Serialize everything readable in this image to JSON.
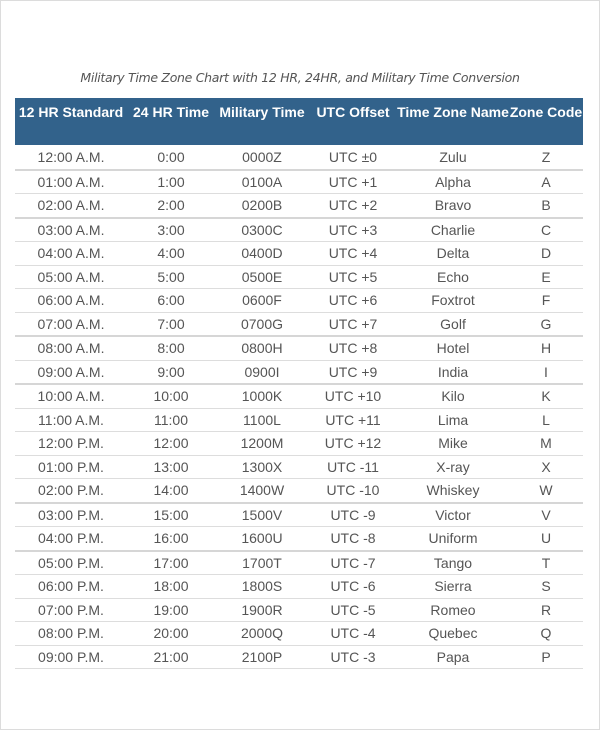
{
  "title": "Military Time Zone Chart with 12 HR, 24HR, and Military Time Conversion",
  "colors": {
    "header_bg": "#32628b",
    "header_text": "#ffffff",
    "cell_text": "#555555",
    "row_divider": "#dddddd"
  },
  "table": {
    "columns": [
      "12 HR Standard",
      "24 HR Time",
      "Military Time",
      "UTC Offset",
      "Time Zone Name",
      "Zone Code"
    ],
    "rows": [
      [
        "12:00 A.M.",
        "0:00",
        "0000Z",
        "UTC ±0",
        "Zulu",
        "Z"
      ],
      [
        "01:00 A.M.",
        "1:00",
        "0100A",
        "UTC +1",
        "Alpha",
        "A"
      ],
      [
        "02:00 A.M.",
        "2:00",
        "0200B",
        "UTC +2",
        "Bravo",
        "B"
      ],
      [
        "03:00 A.M.",
        "3:00",
        "0300C",
        "UTC +3",
        "Charlie",
        "C"
      ],
      [
        "04:00 A.M.",
        "4:00",
        "0400D",
        "UTC +4",
        "Delta",
        "D"
      ],
      [
        "05:00 A.M.",
        "5:00",
        "0500E",
        "UTC +5",
        "Echo",
        "E"
      ],
      [
        "06:00 A.M.",
        "6:00",
        "0600F",
        "UTC +6",
        "Foxtrot",
        "F"
      ],
      [
        "07:00 A.M.",
        "7:00",
        "0700G",
        "UTC +7",
        "Golf",
        "G"
      ],
      [
        "08:00 A.M.",
        "8:00",
        "0800H",
        "UTC +8",
        "Hotel",
        "H"
      ],
      [
        "09:00 A.M.",
        "9:00",
        "0900I",
        "UTC +9",
        "India",
        "I"
      ],
      [
        "10:00 A.M.",
        "10:00",
        "1000K",
        "UTC +10",
        "Kilo",
        "K"
      ],
      [
        "11:00 A.M.",
        "11:00",
        "1100L",
        "UTC +11",
        "Lima",
        "L"
      ],
      [
        "12:00 P.M.",
        "12:00",
        "1200M",
        "UTC +12",
        "Mike",
        "M"
      ],
      [
        "01:00 P.M.",
        "13:00",
        "1300X",
        "UTC -11",
        "X-ray",
        "X"
      ],
      [
        "02:00 P.M.",
        "14:00",
        "1400W",
        "UTC -10",
        "Whiskey",
        "W"
      ],
      [
        "03:00 P.M.",
        "15:00",
        "1500V",
        "UTC -9",
        "Victor",
        "V"
      ],
      [
        "04:00 P.M.",
        "16:00",
        "1600U",
        "UTC -8",
        "Uniform",
        "U"
      ],
      [
        "05:00 P.M.",
        "17:00",
        "1700T",
        "UTC -7",
        "Tango",
        "T"
      ],
      [
        "06:00 P.M.",
        "18:00",
        "1800S",
        "UTC -6",
        "Sierra",
        "S"
      ],
      [
        "07:00 P.M.",
        "19:00",
        "1900R",
        "UTC -5",
        "Romeo",
        "R"
      ],
      [
        "08:00 P.M.",
        "20:00",
        "2000Q",
        "UTC -4",
        "Quebec",
        "Q"
      ],
      [
        "09:00 P.M.",
        "21:00",
        "2100P",
        "UTC -3",
        "Papa",
        "P"
      ]
    ]
  }
}
